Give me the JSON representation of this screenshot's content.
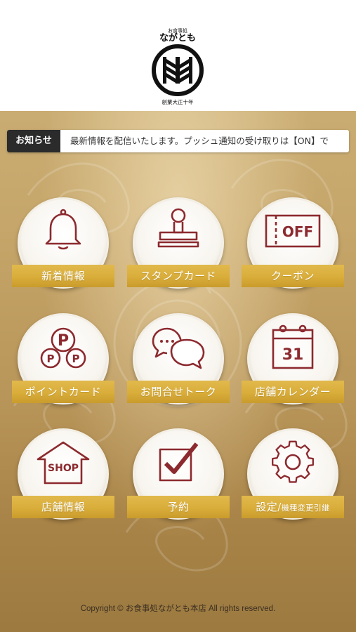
{
  "header": {
    "logo_small_text": "お食事処",
    "logo_name": "ながとも",
    "logo_tagline": "創業大正十年"
  },
  "notice": {
    "label": "お知らせ",
    "text": "最新情報を配信いたします。プッシュ通知の受け取りは【ON】で"
  },
  "menu": [
    {
      "label": "新着情報",
      "icon": "bell-icon"
    },
    {
      "label": "スタンプカード",
      "icon": "stamp-icon"
    },
    {
      "label": "クーポン",
      "icon": "coupon-icon",
      "icon_text": "OFF"
    },
    {
      "label": "ポイントカード",
      "icon": "point-coins-icon",
      "icon_text": "P"
    },
    {
      "label": "お問合せトーク",
      "icon": "chat-bubbles-icon"
    },
    {
      "label": "店舗カレンダー",
      "icon": "calendar-icon",
      "icon_text": "31"
    },
    {
      "label": "店舗情報",
      "icon": "shop-house-icon",
      "icon_text": "SHOP"
    },
    {
      "label": "予約",
      "icon": "checkbox-icon"
    },
    {
      "label": "設定/",
      "label_small": "機種変更引継",
      "icon": "gear-icon"
    }
  ],
  "footer": {
    "copyright": "Copyright © お食事処ながとも本店 All rights reserved."
  },
  "colors": {
    "icon_stroke": "#8c2a2f",
    "ribbon": "#d9ad3a",
    "notice_label_bg": "#2b2b2b"
  }
}
